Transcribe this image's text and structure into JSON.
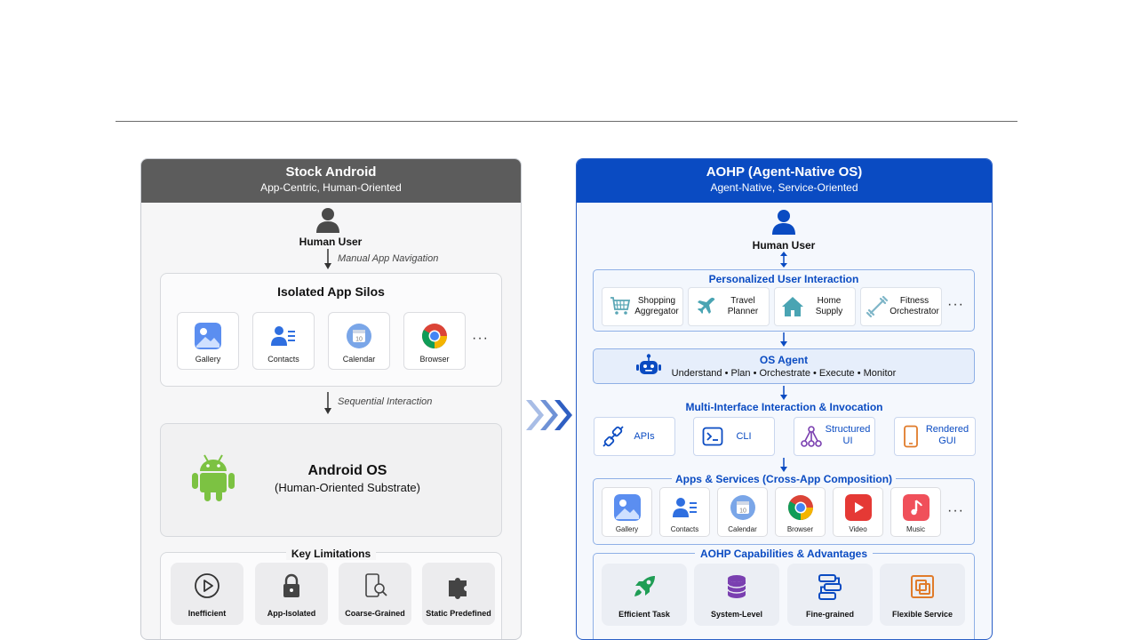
{
  "left_panel": {
    "title": "Stock Android",
    "subtitle": "App-Centric, Human-Oriented",
    "user_label": "Human User",
    "nav_label": "Manual App Navigation",
    "silos": {
      "title": "Isolated App Silos",
      "apps": [
        "Gallery",
        "Contacts",
        "Calendar",
        "Browser"
      ],
      "more": "···"
    },
    "seq_label": "Sequential Interaction",
    "os": {
      "title": "Android OS",
      "subtitle": "(Human-Oriented Substrate)"
    },
    "limitations": {
      "title": "Key Limitations",
      "items": [
        "Inefficient",
        "App-Isolated",
        "Coarse-Grained",
        "Static Predefined"
      ]
    }
  },
  "right_panel": {
    "title": "AOHP (Agent-Native OS)",
    "subtitle": "Agent-Native, Service-Oriented",
    "user_label": "Human User",
    "personalized": {
      "title": "Personalized User Interaction",
      "services": [
        {
          "line1": "Shopping",
          "line2": "Aggregator"
        },
        {
          "line1": "Travel",
          "line2": "Planner"
        },
        {
          "line1": "Home",
          "line2": "Supply"
        },
        {
          "line1": "Fitness",
          "line2": "Orchestrator"
        }
      ],
      "more": "···"
    },
    "os_agent": {
      "title": "OS Agent",
      "subtitle": "Understand • Plan • Orchestrate • Execute • Monitor"
    },
    "multi_interface": {
      "title": "Multi-Interface Interaction & Invocation",
      "items": [
        {
          "line1": "APIs",
          "line2": ""
        },
        {
          "line1": "CLI",
          "line2": ""
        },
        {
          "line1": "Structured",
          "line2": "UI"
        },
        {
          "line1": "Rendered",
          "line2": "GUI"
        }
      ]
    },
    "apps": {
      "title": "Apps & Services (Cross-App Composition)",
      "items": [
        "Gallery",
        "Contacts",
        "Calendar",
        "Browser",
        "Video",
        "Music"
      ],
      "more": "···"
    },
    "capabilities": {
      "title": "AOHP Capabilities & Advantages",
      "items": [
        "Efficient Task",
        "System-Level",
        "Fine-grained",
        "Flexible Service"
      ]
    }
  },
  "colors": {
    "left_header": "#5c5c5c",
    "right_header": "#0a4bc2",
    "accent_blue": "#0a4bc2",
    "android_green": "#7cc242"
  }
}
